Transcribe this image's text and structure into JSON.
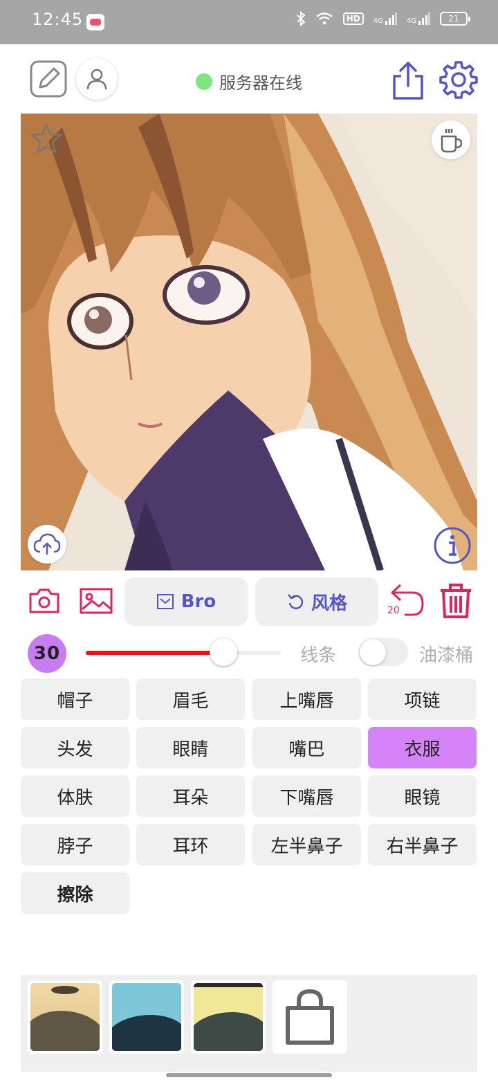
{
  "status_bar": {
    "time": "12:45",
    "hd_label": "HD",
    "signal1_label": "4G",
    "signal2_label": "4G",
    "battery": "21"
  },
  "toolbar": {
    "server_status": "服务器在线",
    "server_status_color": "#7ce77f",
    "accent_color": "#5554c8"
  },
  "controls": {
    "bro_label": "Bro",
    "style_label": "风格",
    "undo_count": "20",
    "brush_accent": "#e0245e"
  },
  "brush": {
    "size": "30",
    "slider_value_fraction": 0.705,
    "line_label": "线条",
    "bucket_label": "油漆桶",
    "bucket_enabled": false
  },
  "parts": [
    {
      "label": "帽子",
      "active": false
    },
    {
      "label": "眉毛",
      "active": false
    },
    {
      "label": "上嘴唇",
      "active": false
    },
    {
      "label": "项链",
      "active": false
    },
    {
      "label": "头发",
      "active": false
    },
    {
      "label": "眼睛",
      "active": false
    },
    {
      "label": "嘴巴",
      "active": false
    },
    {
      "label": "衣服",
      "active": true
    },
    {
      "label": "体肤",
      "active": false
    },
    {
      "label": "耳朵",
      "active": false
    },
    {
      "label": "下嘴唇",
      "active": false
    },
    {
      "label": "眼镜",
      "active": false
    },
    {
      "label": "脖子",
      "active": false
    },
    {
      "label": "耳环",
      "active": false
    },
    {
      "label": "左半鼻子",
      "active": false
    },
    {
      "label": "右半鼻子",
      "active": false
    },
    {
      "label": "擦除",
      "active": false
    }
  ],
  "icons": [
    "edit-icon",
    "user-icon",
    "share-icon",
    "gear-icon",
    "star-icon",
    "coffee-icon",
    "cloud-upload-icon",
    "info-icon",
    "camera-icon",
    "image-icon",
    "undo-icon",
    "trash-icon",
    "shopping-bag-icon"
  ]
}
